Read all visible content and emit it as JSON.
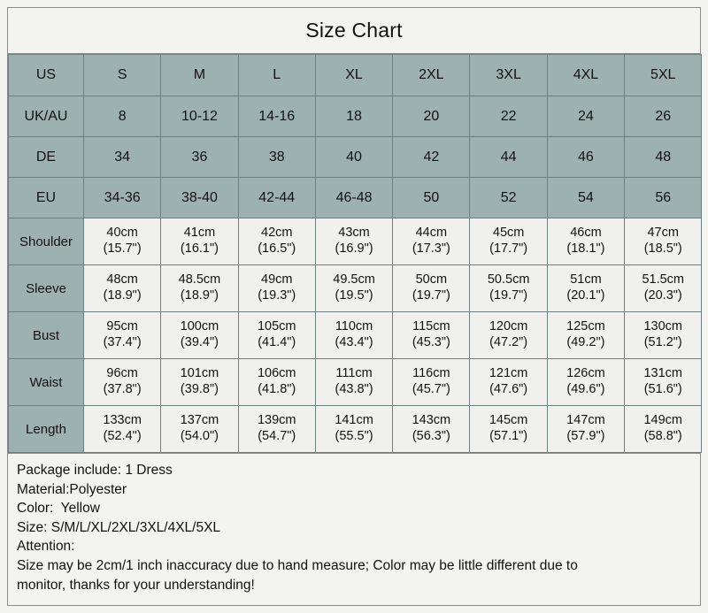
{
  "title": "Size Chart",
  "table": {
    "size_rows": [
      {
        "label": "US",
        "values": [
          "S",
          "M",
          "L",
          "XL",
          "2XL",
          "3XL",
          "4XL",
          "5XL"
        ]
      },
      {
        "label": "UK/AU",
        "values": [
          "8",
          "10-12",
          "14-16",
          "18",
          "20",
          "22",
          "24",
          "26"
        ]
      },
      {
        "label": "DE",
        "values": [
          "34",
          "36",
          "38",
          "40",
          "42",
          "44",
          "46",
          "48"
        ]
      },
      {
        "label": "EU",
        "values": [
          "34-36",
          "38-40",
          "42-44",
          "46-48",
          "50",
          "52",
          "54",
          "56"
        ]
      }
    ],
    "measurement_rows": [
      {
        "label": "Shoulder",
        "cm": [
          "40cm",
          "41cm",
          "42cm",
          "43cm",
          "44cm",
          "45cm",
          "46cm",
          "47cm"
        ],
        "inch": [
          "(15.7\")",
          "(16.1\")",
          "(16.5\")",
          "(16.9\")",
          "(17.3\")",
          "(17.7\")",
          "(18.1\")",
          "(18.5\")"
        ]
      },
      {
        "label": "Sleeve",
        "cm": [
          "48cm",
          "48.5cm",
          "49cm",
          "49.5cm",
          "50cm",
          "50.5cm",
          "51cm",
          "51.5cm"
        ],
        "inch": [
          "(18.9\")",
          "(18.9\")",
          "(19.3\")",
          "(19.5\")",
          "(19.7\")",
          "(19.7\")",
          "(20.1\")",
          "(20.3\")"
        ]
      },
      {
        "label": "Bust",
        "cm": [
          "95cm",
          "100cm",
          "105cm",
          "110cm",
          "115cm",
          "120cm",
          "125cm",
          "130cm"
        ],
        "inch": [
          "(37.4\")",
          "(39.4\")",
          "(41.4\")",
          "(43.4\")",
          "(45.3\")",
          "(47.2\")",
          "(49.2\")",
          "(51.2\")"
        ]
      },
      {
        "label": "Waist",
        "cm": [
          "96cm",
          "101cm",
          "106cm",
          "111cm",
          "116cm",
          "121cm",
          "126cm",
          "131cm"
        ],
        "inch": [
          "(37.8\")",
          "(39.8\")",
          "(41.8\")",
          "(43.8\")",
          "(45.7\")",
          "(47.6\")",
          "(49.6\")",
          "(51.6\")"
        ]
      },
      {
        "label": "Length",
        "cm": [
          "133cm",
          "137cm",
          "139cm",
          "141cm",
          "143cm",
          "145cm",
          "147cm",
          "149cm"
        ],
        "inch": [
          "(52.4\")",
          "(54.0\")",
          "(54.7\")",
          "(55.5\")",
          "(56.3\")",
          "(57.1\")",
          "(57.9\")",
          "(58.8\")"
        ]
      }
    ]
  },
  "notes": {
    "text": "Package include: 1 Dress\nMaterial:Polyester\nColor:  Yellow\nSize: S/M/L/XL/2XL/3XL/4XL/5XL\nAttention:\nSize may be 2cm/1 inch inaccuracy due to hand measure; Color may be little different due to\nmonitor, thanks for your understanding!"
  },
  "colors": {
    "header_cell": "#9db1b0",
    "data_cell": "#f0f0ee",
    "page_background": "#f3f3f1",
    "border": "#6f7f7f",
    "outer_border": "#8c8c8c",
    "text": "#111111"
  }
}
